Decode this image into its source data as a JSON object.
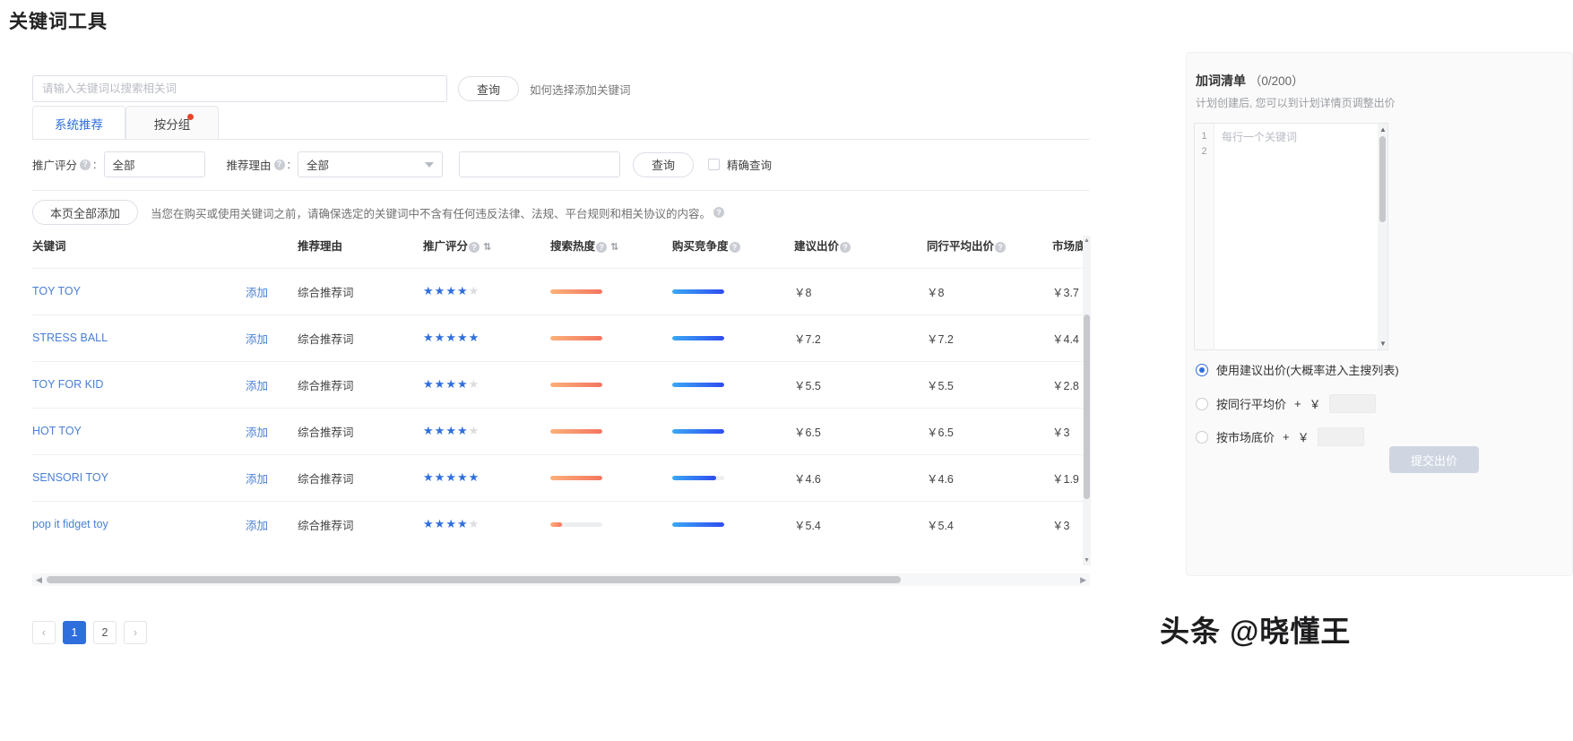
{
  "page_title": "关键词工具",
  "search": {
    "placeholder": "请输入关键词以搜索相关词",
    "value": "",
    "query_button": "查询",
    "hint": "如何选择添加关键词"
  },
  "tabs": [
    {
      "label": "系统推荐",
      "active": true,
      "badge": false
    },
    {
      "label": "按分组",
      "active": false,
      "badge": true
    }
  ],
  "filters": {
    "score_label": "推广评分",
    "score_value": "全部",
    "reason_label": "推荐理由",
    "reason_value": "全部",
    "keyword_value": "",
    "query_button": "查询",
    "exact_label": "精确查询",
    "exact_checked": false
  },
  "add_all": {
    "button": "本页全部添加",
    "notice": "当您在购买或使用关键词之前，请确保选定的关键词中不含有任何违反法律、法规、平台规则和相关协议的内容。"
  },
  "table": {
    "columns": [
      {
        "key": "keyword",
        "label": "关键词",
        "help": false,
        "sort": false
      },
      {
        "key": "add",
        "label": "",
        "help": false,
        "sort": false
      },
      {
        "key": "reason",
        "label": "推荐理由",
        "help": false,
        "sort": false
      },
      {
        "key": "score",
        "label": "推广评分",
        "help": true,
        "sort": true
      },
      {
        "key": "heat",
        "label": "搜索热度",
        "help": true,
        "sort": true
      },
      {
        "key": "competition",
        "label": "购买竞争度",
        "help": true,
        "sort": false
      },
      {
        "key": "suggested_bid",
        "label": "建议出价",
        "help": true,
        "sort": false
      },
      {
        "key": "peer_avg_bid",
        "label": "同行平均出价",
        "help": true,
        "sort": false
      },
      {
        "key": "market_floor",
        "label": "市场底价",
        "help": false,
        "sort": false
      }
    ],
    "add_label": "添加",
    "rows": [
      {
        "keyword": "TOY TOY",
        "reason": "综合推荐词",
        "score": 4,
        "heat": 100,
        "competition": 100,
        "suggested_bid": "￥8",
        "peer_avg_bid": "￥8",
        "market_floor": "￥3.7"
      },
      {
        "keyword": "STRESS BALL",
        "reason": "综合推荐词",
        "score": 5,
        "heat": 100,
        "competition": 100,
        "suggested_bid": "￥7.2",
        "peer_avg_bid": "￥7.2",
        "market_floor": "￥4.4"
      },
      {
        "keyword": "TOY FOR KID",
        "reason": "综合推荐词",
        "score": 4,
        "heat": 100,
        "competition": 100,
        "suggested_bid": "￥5.5",
        "peer_avg_bid": "￥5.5",
        "market_floor": "￥2.8"
      },
      {
        "keyword": "HOT TOY",
        "reason": "综合推荐词",
        "score": 4,
        "heat": 100,
        "competition": 100,
        "suggested_bid": "￥6.5",
        "peer_avg_bid": "￥6.5",
        "market_floor": "￥3"
      },
      {
        "keyword": "SENSORI TOY",
        "reason": "综合推荐词",
        "score": 5,
        "heat": 100,
        "competition": 85,
        "suggested_bid": "￥4.6",
        "peer_avg_bid": "￥4.6",
        "market_floor": "￥1.9"
      },
      {
        "keyword": "pop it fidget toy",
        "reason": "综合推荐词",
        "score": 4,
        "heat": 22,
        "competition": 100,
        "suggested_bid": "￥5.4",
        "peer_avg_bid": "￥5.4",
        "market_floor": "￥3"
      }
    ]
  },
  "pagination": {
    "prev": "‹",
    "next": "›",
    "pages": [
      "1",
      "2"
    ],
    "current": "1"
  },
  "right_panel": {
    "title": "加词清单",
    "count": "（0/200）",
    "subtitle": "计划创建后, 您可以到计划详情页调整出价",
    "editor_placeholder": "每行一个关键词",
    "line_numbers": [
      "1",
      "2"
    ],
    "bid_options": [
      {
        "label": "使用建议出价(大概率进入主搜列表)",
        "selected": true,
        "has_input": false,
        "plus": "",
        "currency": "",
        "value": ""
      },
      {
        "label": "按同行平均价",
        "selected": false,
        "has_input": true,
        "plus": "+",
        "currency": "￥",
        "value": ""
      },
      {
        "label": "按市场底价",
        "selected": false,
        "has_input": true,
        "plus": "+",
        "currency": "￥",
        "value": ""
      }
    ],
    "submit_label": "提交出价"
  },
  "watermark": "头条 @晓懂王",
  "colors": {
    "accent": "#2f6fdd",
    "link": "#4a7fd4",
    "badge": "#e8462b",
    "heat_bar": "#f4755f",
    "competition_bar": "#2f4cf0",
    "star_on": "#2f6fdd",
    "star_off": "#dcdde0"
  }
}
